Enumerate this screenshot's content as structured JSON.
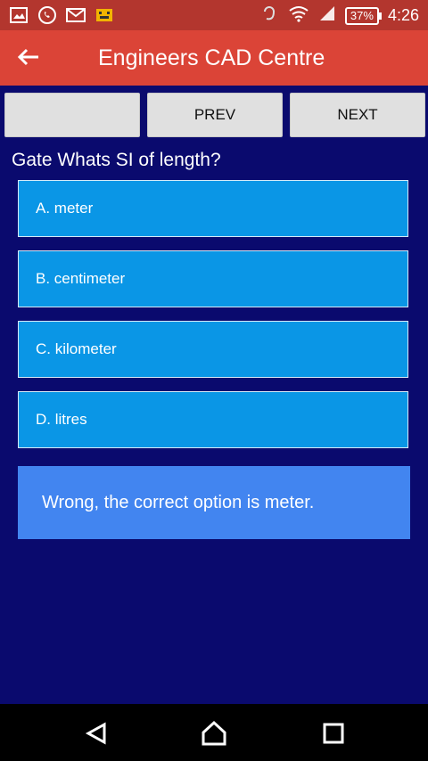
{
  "status_bar": {
    "time": "4:26",
    "battery": "37%",
    "icons": [
      "picture-icon",
      "whatsapp-icon",
      "gmail-icon",
      "android-icon"
    ]
  },
  "app_bar": {
    "title": "Engineers CAD Centre",
    "back_icon": "arrow-left-icon"
  },
  "buttons": {
    "blank_label": "",
    "prev_label": "PREV",
    "next_label": "NEXT"
  },
  "question": "Gate Whats SI of length?",
  "options": [
    {
      "label": "A. meter"
    },
    {
      "label": "B. centimeter"
    },
    {
      "label": "C. kilometer"
    },
    {
      "label": "D. litres"
    }
  ],
  "feedback": "Wrong, the correct option is meter.",
  "nav_bar": {
    "icons": [
      "back-triangle-icon",
      "home-icon",
      "recents-icon"
    ]
  },
  "colors": {
    "background": "#0a0a6e",
    "app_bar": "#db4437",
    "status_bar": "#b3362e",
    "option": "#0a96e6",
    "feedback": "#4285f0"
  }
}
